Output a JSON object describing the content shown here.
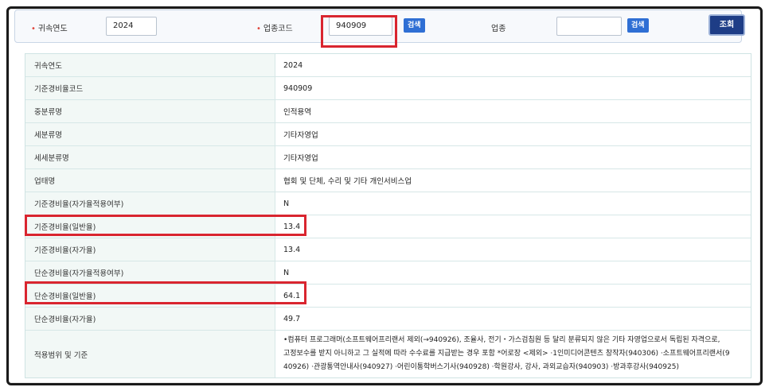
{
  "search": {
    "year_label": "귀속연도",
    "year_value": "2024",
    "code_label": "업종코드",
    "code_value": "940909",
    "code_search_button": "검색",
    "industry_label": "업종",
    "industry_value": "",
    "industry_search_button": "검색",
    "query_button": "조회",
    "required_mark": "•"
  },
  "rows": [
    {
      "label": "귀속연도",
      "value": "2024"
    },
    {
      "label": "기준경비율코드",
      "value": "940909"
    },
    {
      "label": "중분류명",
      "value": "인적용역"
    },
    {
      "label": "세분류명",
      "value": "기타자영업"
    },
    {
      "label": "세세분류명",
      "value": "기타자영업"
    },
    {
      "label": "업태명",
      "value": "협회 및 단체, 수리 및 기타 개인서비스업"
    },
    {
      "label": "기준경비율(자가율적용여부)",
      "value": "N"
    },
    {
      "label": "기준경비율(일반율)",
      "value": "13.4"
    },
    {
      "label": "기준경비율(자가율)",
      "value": "13.4"
    },
    {
      "label": "단순경비율(자가율적용여부)",
      "value": "N"
    },
    {
      "label": "단순경비율(일반율)",
      "value": "64.1"
    },
    {
      "label": "단순경비율(자가율)",
      "value": "49.7"
    },
    {
      "label": "적용범위 및 기준",
      "value_lines": [
        "•컴퓨터 프로그래머(소프트웨어프리랜서 제외(→940926), 조율사, 전기・가스검침원 등 달리 분류되지 않은 기타 자영업으로서 독립된 자격으로,",
        "고정보수를 받지 아니하고 그 실적에 따라 수수료를 지급받는 경우 포함 *어로장 <제외> ·1인미디어콘텐츠 창작자(940306) ·소프트웨어프리랜서(9",
        "40926) ·관광통역안내사(940927) ·어린이통학버스기사(940928) ·학원강사, 강사, 과외교습자(940903) ·방과후강사(940925)"
      ]
    }
  ],
  "colors": {
    "highlight": "#d9252f",
    "primary_button": "#2f6fd4",
    "query_button": "#1e3d86",
    "header_cell": "#f2f8f6"
  }
}
